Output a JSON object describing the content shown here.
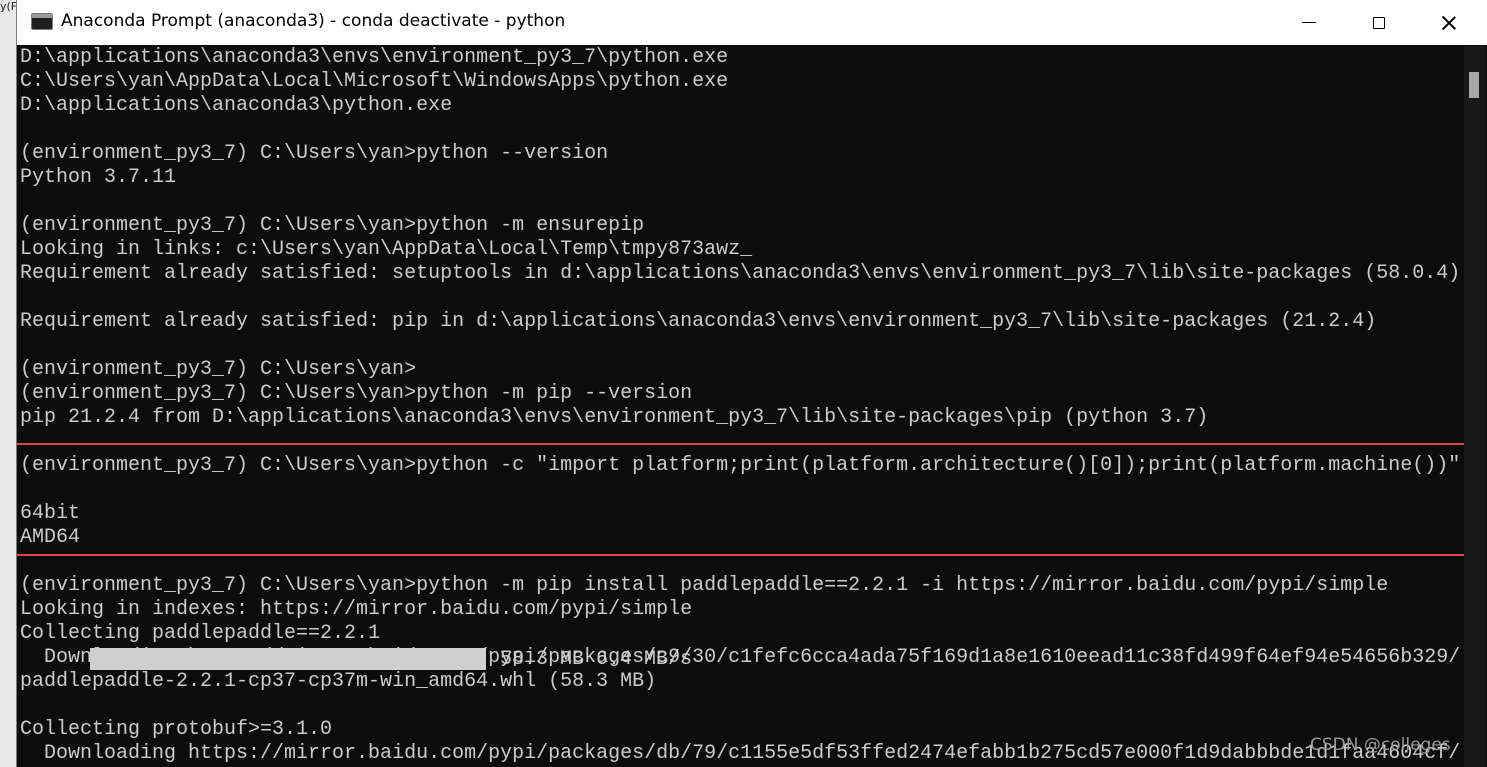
{
  "window": {
    "title": "Anaconda Prompt (anaconda3) - conda  deactivate - python",
    "left_strip_text": "y(Fi"
  },
  "console": {
    "lines": [
      "D:\\applications\\anaconda3\\envs\\environment_py3_7\\python.exe",
      "C:\\Users\\yan\\AppData\\Local\\Microsoft\\WindowsApps\\python.exe",
      "D:\\applications\\anaconda3\\python.exe",
      "",
      "(environment_py3_7) C:\\Users\\yan>python --version",
      "Python 3.7.11",
      "",
      "(environment_py3_7) C:\\Users\\yan>python -m ensurepip",
      "Looking in links: c:\\Users\\yan\\AppData\\Local\\Temp\\tmpy873awz_",
      "Requirement already satisfied: setuptools in d:\\applications\\anaconda3\\envs\\environment_py3_7\\lib\\site-packages (58.0.4)",
      "",
      "Requirement already satisfied: pip in d:\\applications\\anaconda3\\envs\\environment_py3_7\\lib\\site-packages (21.2.4)",
      "",
      "(environment_py3_7) C:\\Users\\yan>",
      "(environment_py3_7) C:\\Users\\yan>python -m pip --version",
      "pip 21.2.4 from D:\\applications\\anaconda3\\envs\\environment_py3_7\\lib\\site-packages\\pip (python 3.7)",
      "",
      "(environment_py3_7) C:\\Users\\yan>python -c \"import platform;print(platform.architecture()[0]);print(platform.machine())\"",
      "",
      "64bit",
      "AMD64",
      "",
      "(environment_py3_7) C:\\Users\\yan>python -m pip install paddlepaddle==2.2.1 -i https://mirror.baidu.com/pypi/simple",
      "Looking in indexes: https://mirror.baidu.com/pypi/simple",
      "Collecting paddlepaddle==2.2.1",
      "  Downloading https://mirror.baidu.com/pypi/packages/c9/30/c1fefc6cca4ada75f169d1a8e1610eead11c38fd499f64ef94e54656b329/",
      "paddlepaddle-2.2.1-cp37-cp37m-win_amd64.whl (58.3 MB)",
      "",
      "Collecting protobuf>=3.1.0",
      "  Downloading https://mirror.baidu.com/pypi/packages/db/79/c1155e5df53ffed2474efabb1b275cd57e000f1d9dabbbde1d1faa4604cf/"
    ]
  },
  "download": {
    "progress_fraction": 1.0,
    "progress_text": "58.3 MB 6.4 MB/s"
  },
  "watermark": "CSDN @colleges",
  "colors": {
    "terminal_bg": "#0c0c0c",
    "terminal_fg": "#cccccc",
    "highlight_border": "#e04545",
    "titlebar_bg": "#ffffff"
  },
  "icons": {
    "app": "console-window-icon",
    "minimize": "minimize-icon",
    "maximize": "maximize-icon",
    "close": "close-icon"
  }
}
